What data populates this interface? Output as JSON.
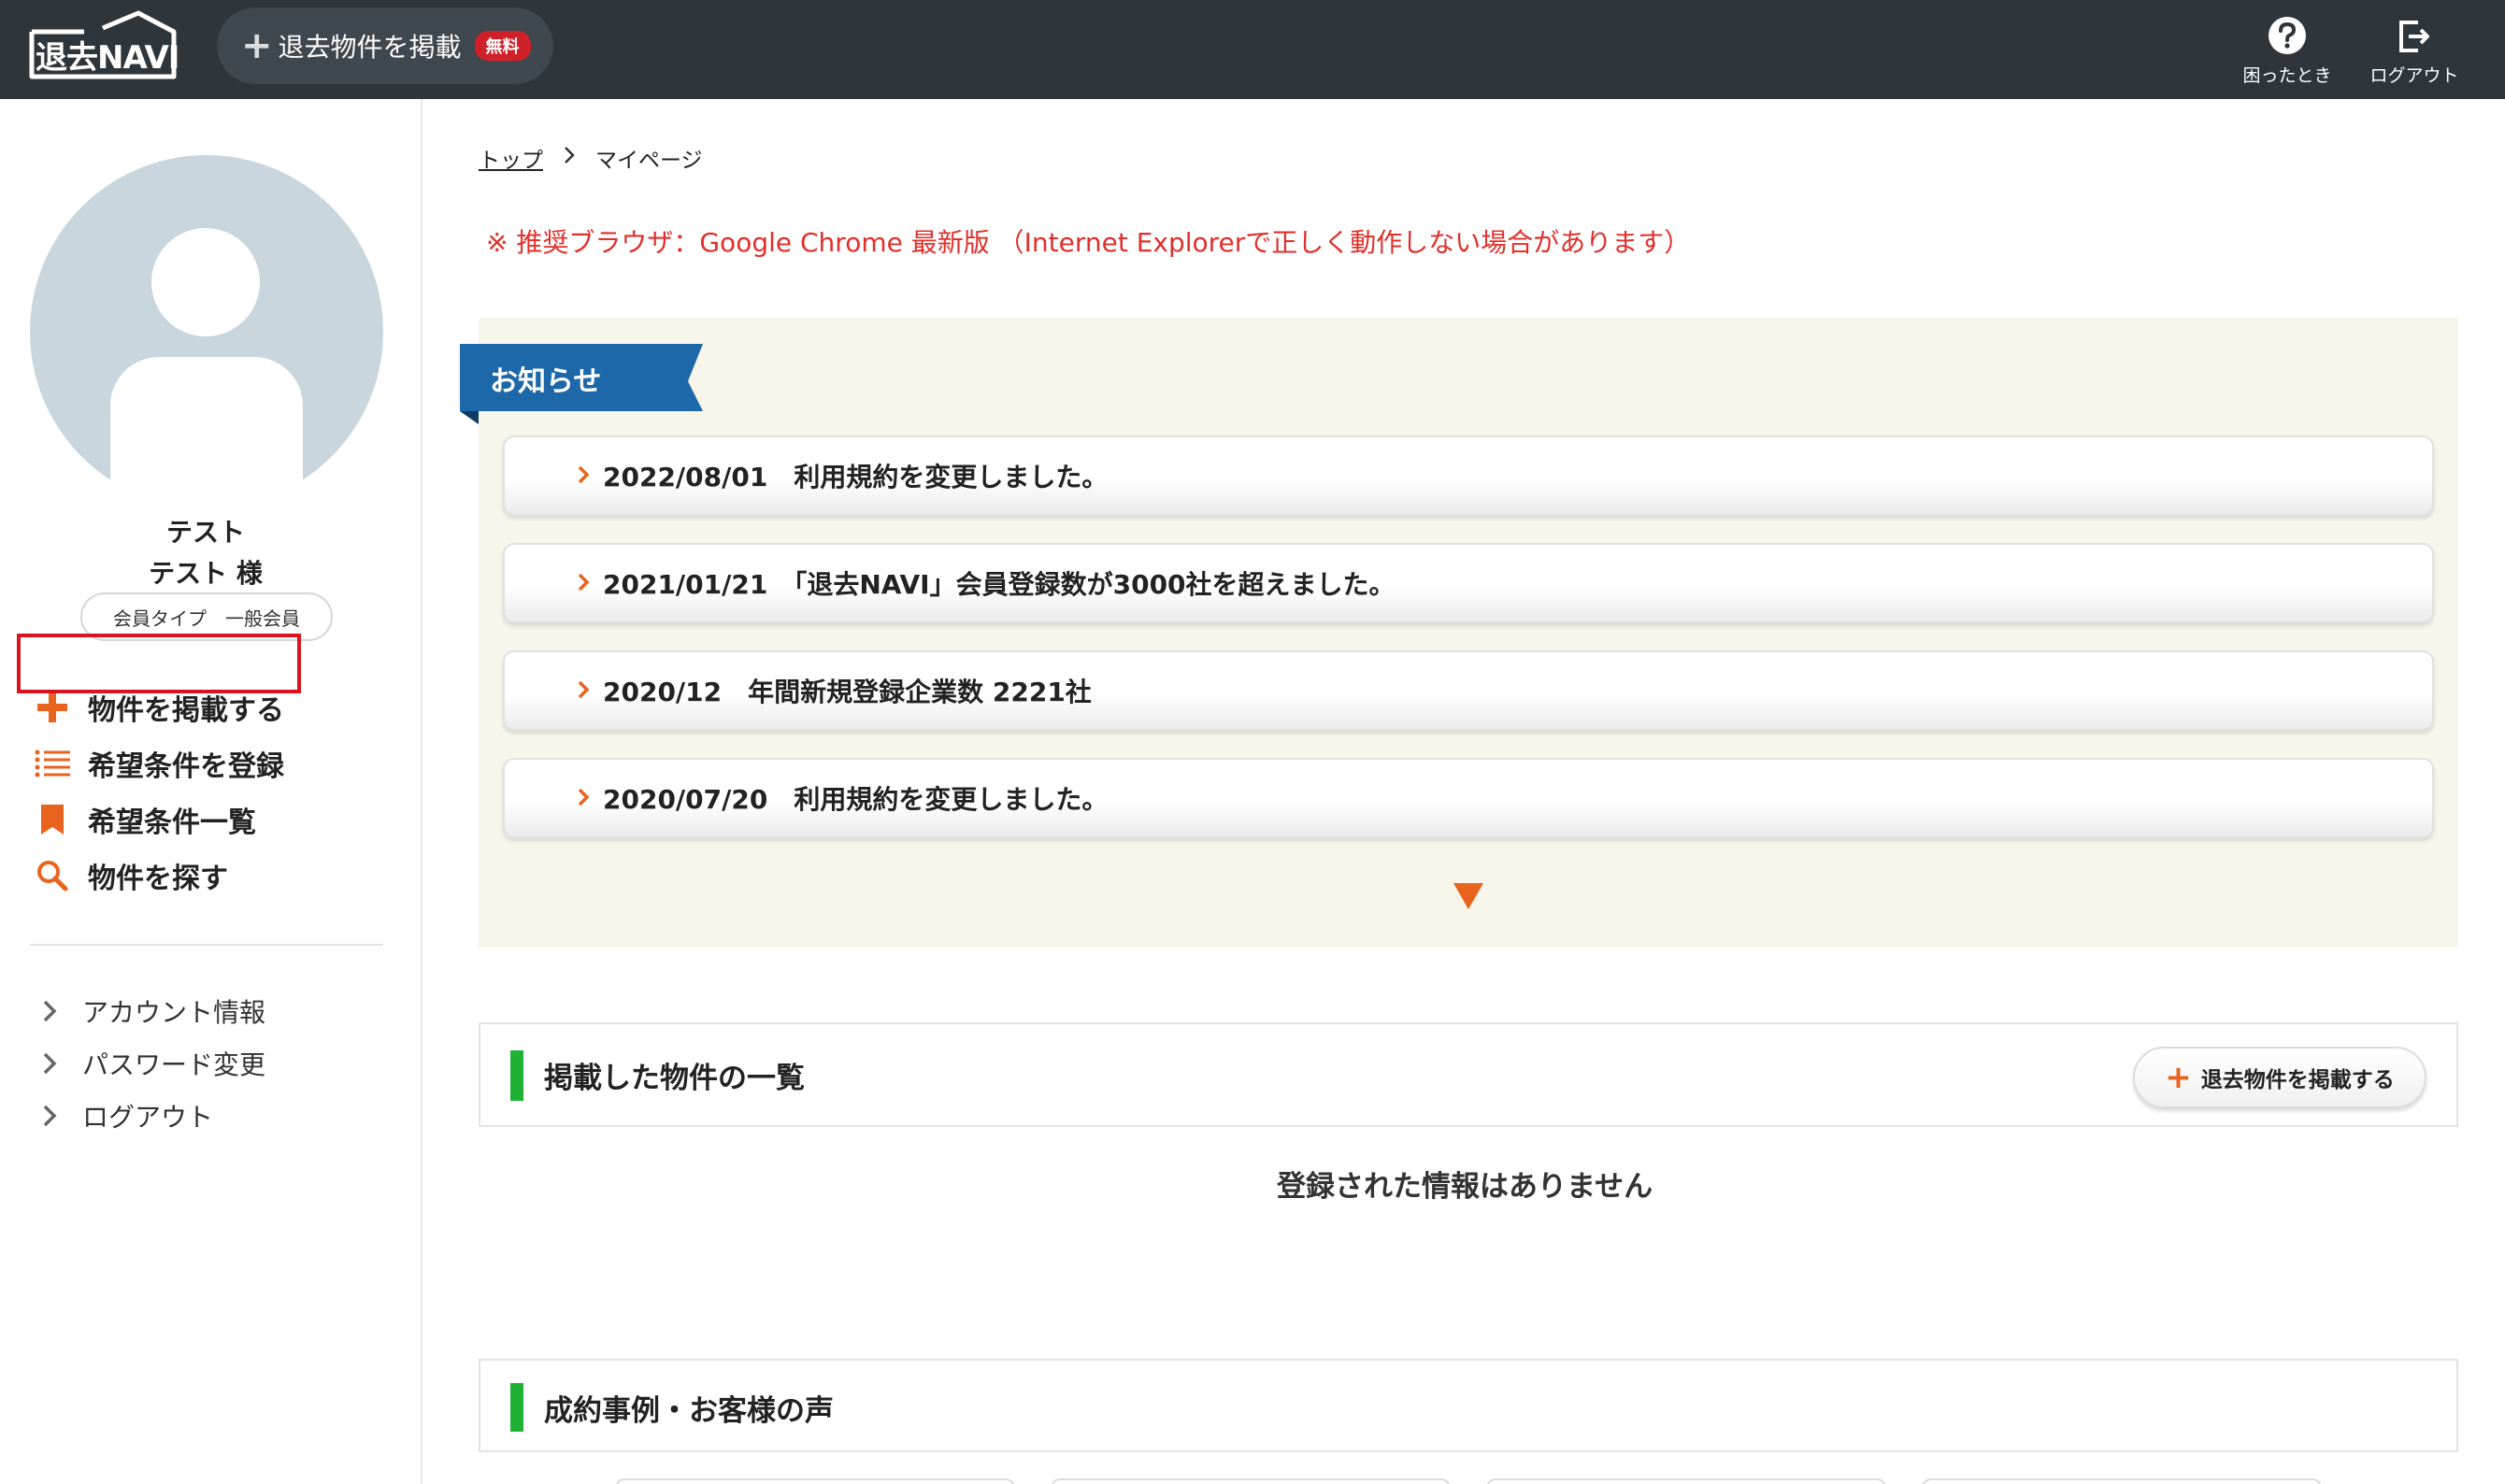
{
  "header": {
    "logo_text": "退去NAVI",
    "post_button_label": "退去物件を掲載",
    "post_button_badge": "無料",
    "help_label": "困ったとき",
    "logout_label": "ログアウト"
  },
  "sidebar": {
    "user_name_line1": "テスト",
    "user_name_line2": "テスト 様",
    "member_type": "会員タイプ　一般会員",
    "menu": [
      {
        "label": "物件を掲載する",
        "icon": "plus-icon"
      },
      {
        "label": "希望条件を登録",
        "icon": "list-icon"
      },
      {
        "label": "希望条件一覧",
        "icon": "bookmark-icon"
      },
      {
        "label": "物件を探す",
        "icon": "search-icon"
      }
    ],
    "sub_menu": [
      {
        "label": "アカウント情報"
      },
      {
        "label": "パスワード変更"
      },
      {
        "label": "ログアウト"
      }
    ]
  },
  "main": {
    "breadcrumb": {
      "top": "トップ",
      "current": "マイページ"
    },
    "browser_notice": "※ 推奨ブラウザ：Google Chrome 最新版 （Internet Explorerで正しく動作しない場合があります）",
    "news": {
      "title": "お知らせ",
      "items": [
        {
          "text": "2022/08/01　利用規約を変更しました。"
        },
        {
          "text": "2021/01/21　「退去NAVI」会員登録数が3000社を超えました。"
        },
        {
          "text": "2020/12　年間新規登録企業数 2221社"
        },
        {
          "text": "2020/07/20　利用規約を変更しました。"
        }
      ]
    },
    "listings": {
      "title": "掲載した物件の一覧",
      "post_button": "退去物件を掲載する",
      "empty_message": "登録された情報はありません"
    },
    "cases": {
      "title": "成約事例・お客様の声"
    }
  },
  "colors": {
    "header_bg": "#2e353b",
    "accent_orange": "#e8641e",
    "news_blue": "#1d68a8",
    "notice_red": "#e0302b",
    "section_green": "#20b234",
    "highlight_red": "#d9141e"
  }
}
